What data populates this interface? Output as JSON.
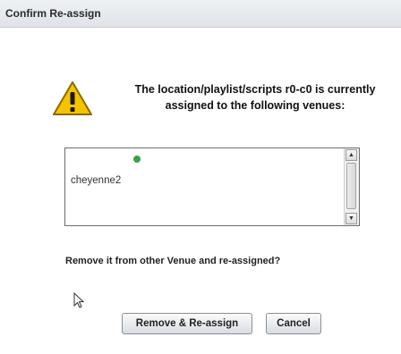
{
  "dialog": {
    "title": "Confirm Re-assign",
    "message": "The location/playlist/scripts r0-c0 is currently assigned to the following venues:",
    "icon": "warning-icon",
    "venues": [
      "cheyenne2"
    ],
    "prompt": "Remove it from other Venue and re-assigned?",
    "buttons": {
      "remove_reassign": "Remove & Re-assign",
      "cancel": "Cancel"
    }
  },
  "colors": {
    "warning_fill": "#f5c400",
    "warning_stroke": "#8a6a00",
    "titlebar": "#e4e8ec"
  }
}
